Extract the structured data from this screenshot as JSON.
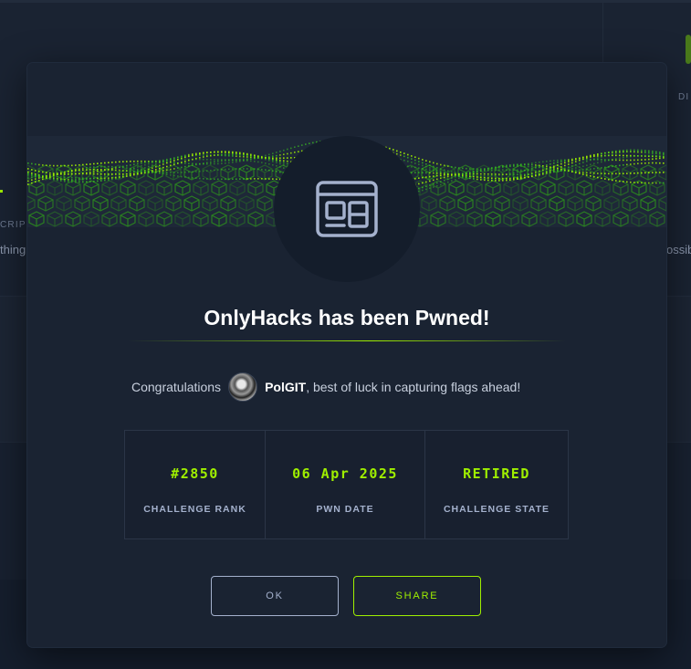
{
  "background": {
    "left_label": "CRIPT",
    "left_text": "thing",
    "right_label": "DI",
    "right_text": "ossib"
  },
  "modal": {
    "title": "OnlyHacks has been Pwned!",
    "congrats_prefix": "Congratulations",
    "username": "PolGIT",
    "congrats_suffix": ", best of luck in capturing flags ahead!",
    "challenge_icon": "web-browser-icon",
    "stats": [
      {
        "value": "#2850",
        "label": "CHALLENGE RANK"
      },
      {
        "value": "06 Apr 2025",
        "label": "PWN DATE"
      },
      {
        "value": "RETIRED",
        "label": "CHALLENGE STATE"
      }
    ],
    "buttons": {
      "ok": "OK",
      "share": "SHARE"
    }
  },
  "colors": {
    "accent": "#9fef00",
    "modal_bg": "#1a2332",
    "page_bg": "#141d2b",
    "text_muted": "#a4b1cd"
  }
}
